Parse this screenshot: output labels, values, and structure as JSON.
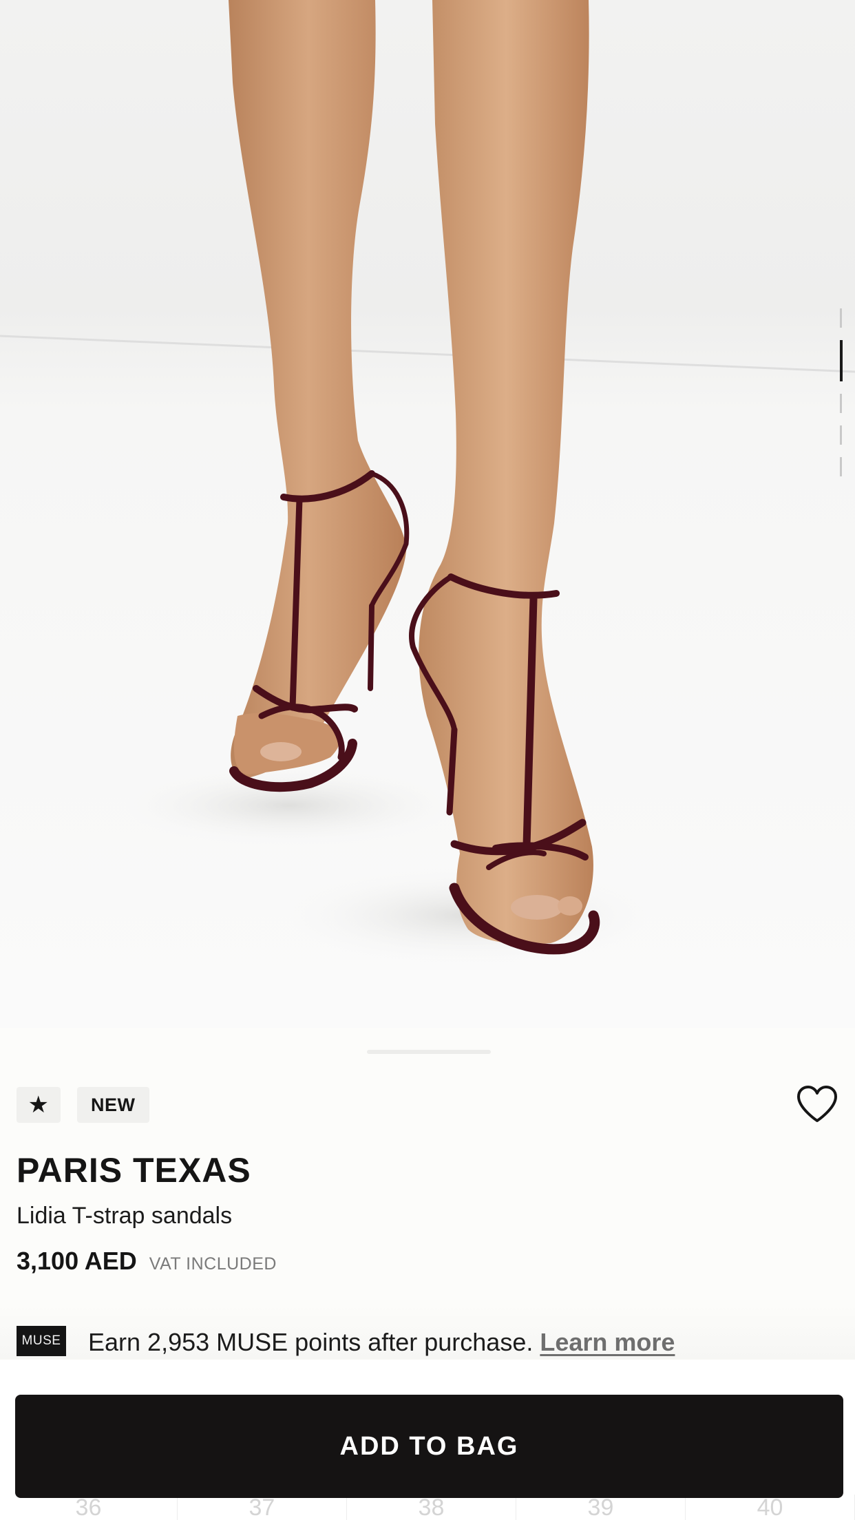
{
  "product": {
    "brand": "PARIS TEXAS",
    "name": "Lidia T-strap sandals",
    "price": "3,100 AED",
    "vat_note": "VAT INCLUDED",
    "badges": {
      "star": "★",
      "new": "NEW"
    },
    "image_pager": {
      "count": 5,
      "active_index": 1
    }
  },
  "loyalty": {
    "logo_text": "MUSE",
    "message": "Earn 2,953 MUSE points after purchase. ",
    "learn_more": "Learn more"
  },
  "actions": {
    "add_to_bag": "ADD TO BAG",
    "favorite_icon": "heart-outline-icon"
  },
  "sizes": [
    "36",
    "37",
    "38",
    "39",
    "40"
  ],
  "colors": {
    "button_bg": "#151313",
    "button_text": "#ffffff",
    "sandal": "#5a1420",
    "skin": "#c99670"
  }
}
